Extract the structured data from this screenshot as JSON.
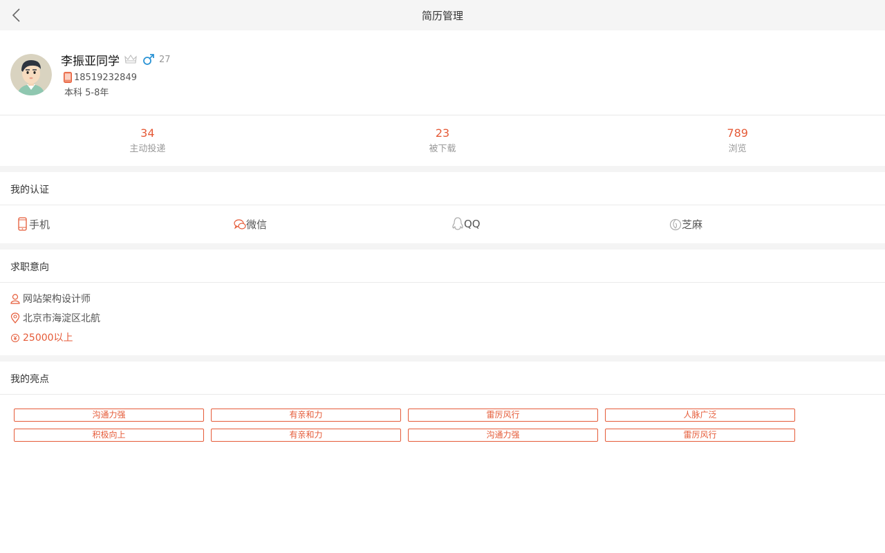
{
  "header": {
    "title": "简历管理",
    "back_icon": "chevron-left-icon"
  },
  "profile": {
    "name": "李振亚同学",
    "age": "27",
    "phone": "18519232849",
    "education": "本科 5-8年",
    "avatar_icon": "cartoon-man-avatar",
    "badge_icon": "crown-icon",
    "gender_icon": "male-icon"
  },
  "stats": [
    {
      "value": "34",
      "label": "主动投递"
    },
    {
      "value": "23",
      "label": "被下载"
    },
    {
      "value": "789",
      "label": "浏览"
    }
  ],
  "certification": {
    "title": "我的认证",
    "items": [
      {
        "label": "手机",
        "icon": "phone-icon"
      },
      {
        "label": "微信",
        "icon": "wechat-icon"
      },
      {
        "label": "QQ",
        "icon": "qq-icon"
      },
      {
        "label": "芝麻",
        "icon": "sesame-icon"
      }
    ]
  },
  "intention": {
    "title": "求职意向",
    "position": "网站架构设计师",
    "location": "北京市海淀区北航",
    "salary": "25000以上"
  },
  "highlights": {
    "title": "我的亮点",
    "tags": [
      "沟通力强",
      "有亲和力",
      "雷厉风行",
      "人脉广泛",
      "积极向上",
      "有亲和力",
      "沟通力强",
      "雷厉风行"
    ]
  },
  "colors": {
    "accent": "#e55a37",
    "topbar_bg": "#f5f5f5",
    "male_blue": "#2a93d5"
  }
}
